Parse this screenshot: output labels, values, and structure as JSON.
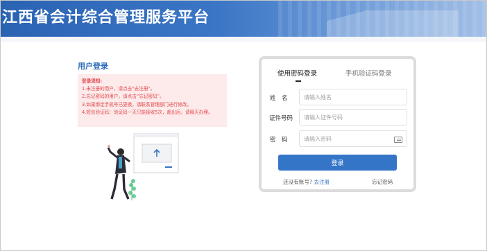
{
  "header": {
    "title": "江西省会计综合管理服务平台"
  },
  "left": {
    "heading": "用户登录",
    "notice_title": "登录须知:",
    "notice_items": [
      "1.未注册的用户，请点击“去注册”。",
      "2.忘记密码的用户，请点击“忘记密码”。",
      "3.如果绑定手机号已更换，请联系管理部门进行修改。",
      "4.短信验证码：验证码一天只能接收5次，超出后，请隔天办理。"
    ]
  },
  "login": {
    "tabs": [
      {
        "label": "使用密码登录",
        "active": true
      },
      {
        "label": "手机验证码登录",
        "active": false
      }
    ],
    "name_label": "姓　名",
    "name_placeholder": "请输入姓名",
    "id_label": "证件号码",
    "id_placeholder": "请输入证件号码",
    "password_label": "密　码",
    "password_placeholder": "请输入密码",
    "login_button": "登录",
    "no_account_text": "还没有账号?",
    "register_link": "去注册",
    "forgot_link": "忘记密码"
  },
  "colors": {
    "primary": "#3575c8",
    "notice_bg": "#fdeaea",
    "notice_text": "#e0474c"
  }
}
